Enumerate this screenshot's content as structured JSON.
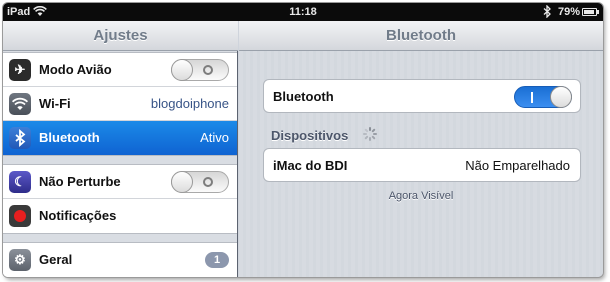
{
  "status_bar": {
    "device": "iPad",
    "time": "11:18",
    "battery": "79%",
    "icons": [
      "wifi-icon",
      "bluetooth-icon",
      "battery-icon"
    ]
  },
  "left": {
    "title": "Ajustes",
    "items": [
      {
        "label": "Modo Avião",
        "icon": "airplane-icon",
        "control": "switch-off"
      },
      {
        "label": "Wi-Fi",
        "value": "blogdoiphone",
        "icon": "wifi-icon"
      },
      {
        "label": "Bluetooth",
        "value": "Ativo",
        "icon": "bluetooth-icon",
        "selected": true
      },
      {
        "label": "Não Perturbe",
        "icon": "moon-icon",
        "control": "switch-off"
      },
      {
        "label": "Notificações",
        "icon": "notifications-icon"
      },
      {
        "label": "Geral",
        "icon": "gear-icon",
        "badge": "1"
      }
    ]
  },
  "right": {
    "title": "Bluetooth",
    "bluetooth_row": {
      "label": "Bluetooth",
      "switch_on": "I"
    },
    "section_header": "Dispositivos",
    "device": {
      "name": "iMac do BDI",
      "status": "Não Emparelhado"
    },
    "footer": "Agora Visível"
  },
  "colors": {
    "selection_blue": "#0f63d2",
    "switch_on_blue": "#1a6fd4",
    "navbar_text": "#717c8a",
    "value_text": "#385487"
  }
}
